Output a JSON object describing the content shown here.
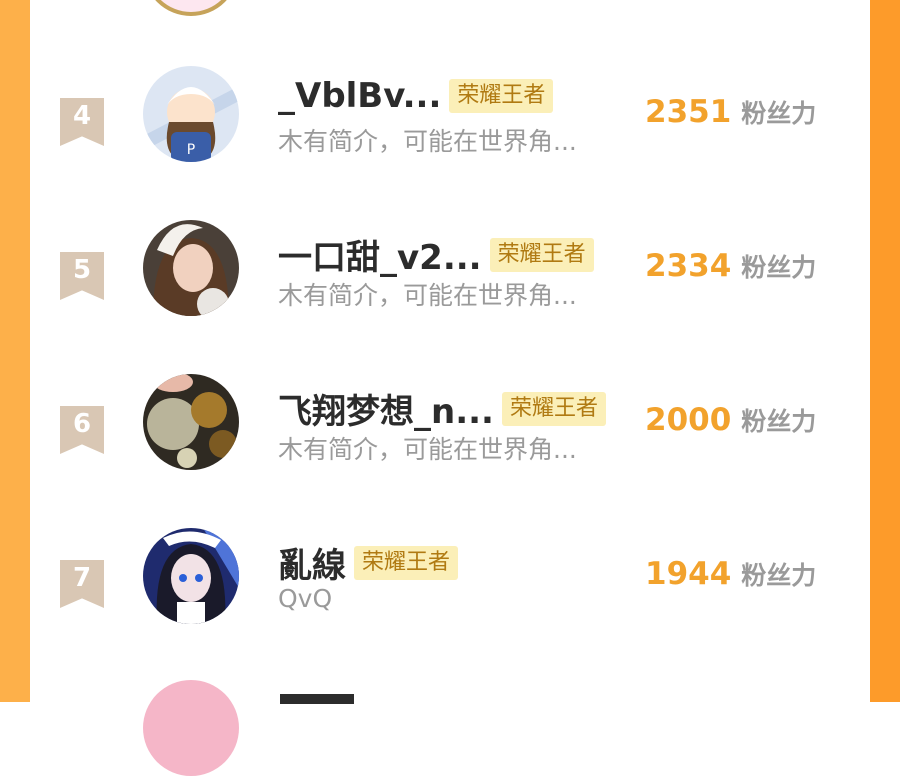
{
  "score_unit": "粉丝力",
  "rows": [
    {
      "rank": "4",
      "name": "_VblBv...",
      "badge": "荣耀王者",
      "intro": "木有简介，可能在世界角...",
      "score": "2351"
    },
    {
      "rank": "5",
      "name": "一口甜_v2...",
      "badge": "荣耀王者",
      "intro": "木有简介，可能在世界角...",
      "score": "2334"
    },
    {
      "rank": "6",
      "name": "飞翔梦想_n...",
      "badge": "荣耀王者",
      "intro": "木有简介，可能在世界角...",
      "score": "2000"
    },
    {
      "rank": "7",
      "name": "亂線",
      "badge": "荣耀王者",
      "intro": "QvQ",
      "score": "1944"
    }
  ],
  "colors": {
    "accent_orange": "#f2a22c",
    "badge_bg": "#fbefb8",
    "rank_bg": "#d9c7b4",
    "side_bg": "#fdb04a"
  }
}
